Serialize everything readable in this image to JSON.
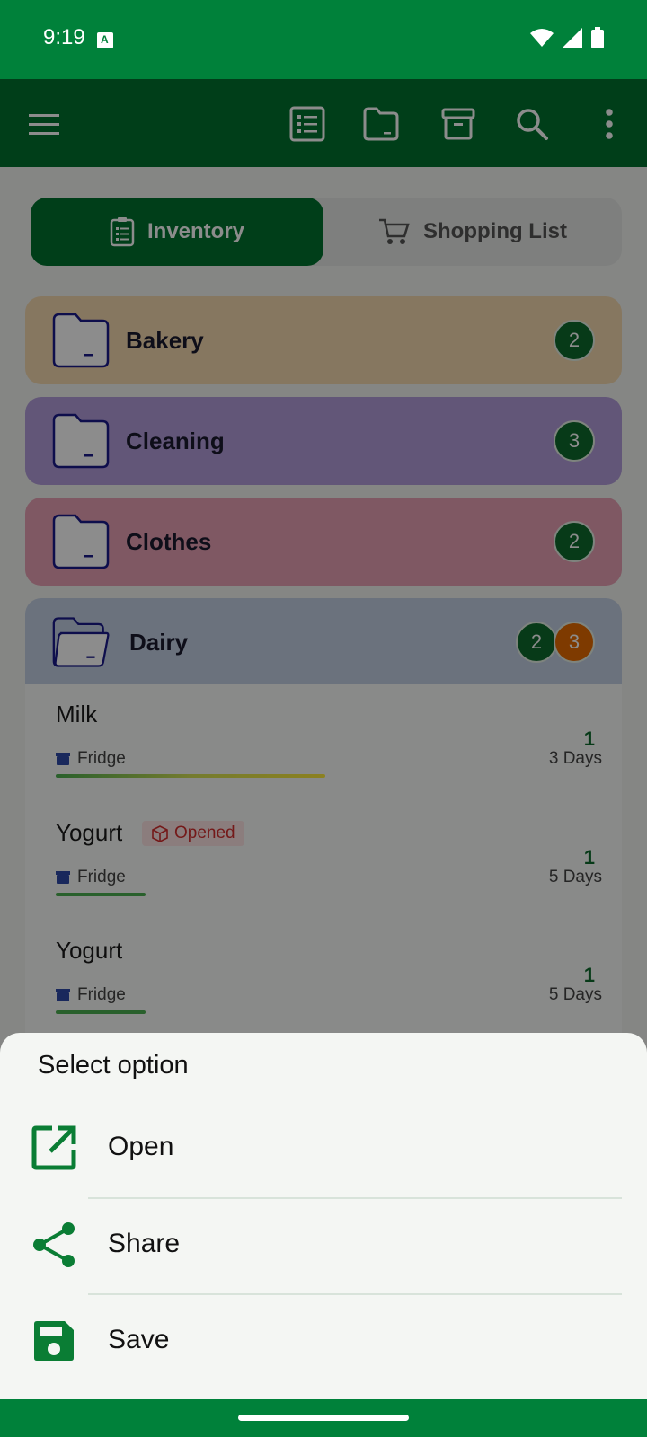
{
  "status_bar": {
    "time": "9:19"
  },
  "app_bar": {
    "icons": [
      "list-icon",
      "folder-icon",
      "archive-icon",
      "search-icon",
      "more-vert-icon"
    ]
  },
  "segments": {
    "inventory": "Inventory",
    "shopping": "Shopping List"
  },
  "categories": [
    {
      "name": "Bakery",
      "count": "2",
      "color": "#f4d9b0"
    },
    {
      "name": "Cleaning",
      "count": "3",
      "color": "#b39ddb"
    },
    {
      "name": "Clothes",
      "count": "2",
      "color": "#e8a0b4"
    },
    {
      "name": "Dairy",
      "count": "2",
      "expiring": "3",
      "color": "#c4d0e4"
    }
  ],
  "dairy_items": [
    {
      "name": "Milk",
      "location": "Fridge",
      "quantity": "1",
      "days": "3 Days",
      "tag": "",
      "freshness": 0.45
    },
    {
      "name": "Yogurt",
      "location": "Fridge",
      "quantity": "1",
      "days": "5 Days",
      "tag": "Opened",
      "freshness": 0.15
    },
    {
      "name": "Yogurt",
      "location": "Fridge",
      "quantity": "1",
      "days": "5 Days",
      "tag": "",
      "freshness": 0.15
    }
  ],
  "sheet": {
    "title": "Select option",
    "options": [
      {
        "label": "Open",
        "icon": "open-in-new-icon"
      },
      {
        "label": "Share",
        "icon": "share-icon"
      },
      {
        "label": "Save",
        "icon": "save-icon"
      }
    ]
  },
  "colors": {
    "primary": "#00813a",
    "primary_dark": "#00722f",
    "badge_green": "#0d6b2c",
    "badge_orange": "#e56b00",
    "opened_red": "#d32f2f"
  }
}
